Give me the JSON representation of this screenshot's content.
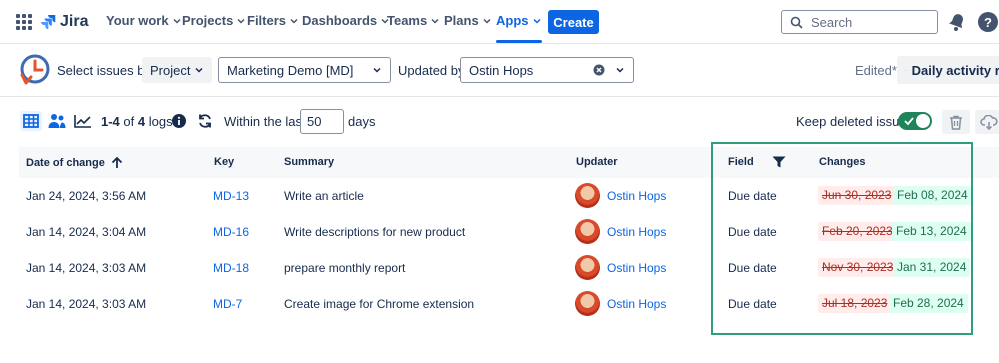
{
  "nav": {
    "logo": "Jira",
    "items": [
      {
        "label": "Your work"
      },
      {
        "label": "Projects"
      },
      {
        "label": "Filters"
      },
      {
        "label": "Dashboards"
      },
      {
        "label": "Teams"
      },
      {
        "label": "Plans"
      },
      {
        "label": "Apps"
      }
    ],
    "active": "Apps",
    "create_label": "Create",
    "search_placeholder": "Search",
    "help_glyph": "?"
  },
  "filters": {
    "select_label": "Select issues by:",
    "select_value": "Project",
    "project_value": "Marketing Demo [MD]",
    "updated_by_label": "Updated by:",
    "updated_by_value": "Ostin Hops",
    "edited": "Edited*",
    "report_label": "Daily activity re"
  },
  "toolbar": {
    "range": "1-4",
    "of": "of",
    "total": "4",
    "logs": "logs",
    "within_label": "Within the last:",
    "days_value": "50",
    "days_label": "days",
    "keep_deleted_label": "Keep deleted issues",
    "keep_deleted_on": true
  },
  "table": {
    "columns": {
      "date": "Date of change",
      "key": "Key",
      "summary": "Summary",
      "updater": "Updater",
      "field": "Field",
      "changes": "Changes"
    },
    "rows": [
      {
        "date": "Jan 24, 2024, 3:56 AM",
        "key": "MD-13",
        "summary": "Write an article",
        "updater": "Ostin Hops",
        "field": "Due date",
        "old": "Jun 30, 2023",
        "new": "Feb 08, 2024"
      },
      {
        "date": "Jan 14, 2024, 3:04 AM",
        "key": "MD-16",
        "summary": "Write descriptions for new product",
        "updater": "Ostin Hops",
        "field": "Due date",
        "old": "Feb 20, 2023",
        "new": "Feb 13, 2024"
      },
      {
        "date": "Jan 14, 2024, 3:03 AM",
        "key": "MD-18",
        "summary": "prepare monthly report",
        "updater": "Ostin Hops",
        "field": "Due date",
        "old": "Nov 30, 2023",
        "new": "Jan 31, 2024"
      },
      {
        "date": "Jan 14, 2024, 3:03 AM",
        "key": "MD-7",
        "summary": "Create image for Chrome extension",
        "updater": "Ostin Hops",
        "field": "Due date",
        "old": "Jul 18, 2023",
        "new": "Feb 28, 2024"
      }
    ]
  },
  "colors": {
    "accent": "#0c66e4",
    "highlight_border": "#2e9e7c",
    "old_value_bg": "#ffeceb",
    "new_value_bg": "#dcfff1"
  }
}
